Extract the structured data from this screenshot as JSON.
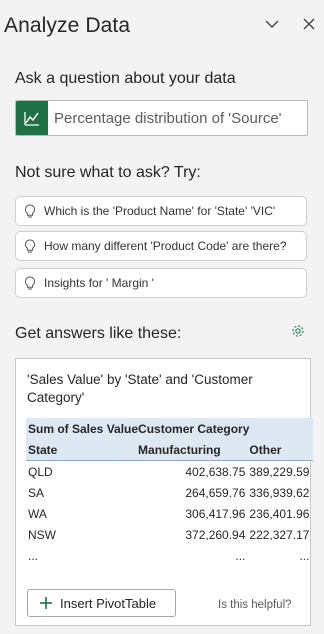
{
  "pane": {
    "title": "Analyze Data"
  },
  "ask": {
    "heading": "Ask a question about your data",
    "value": "Percentage distribution of 'Source'"
  },
  "suggestions": {
    "heading": "Not sure what to ask? Try:",
    "items": [
      {
        "label": "Which is the 'Product Name' for 'State' 'VIC'"
      },
      {
        "label": "How many different 'Product Code' are there?"
      },
      {
        "label": "Insights for ' Margin '"
      }
    ]
  },
  "answers": {
    "heading": "Get answers like these:",
    "card": {
      "title": "'Sales Value' by 'State' and 'Customer Category'",
      "header_row1": [
        "Sum of Sales Value",
        "Customer Category",
        ""
      ],
      "header_row2": [
        "State",
        "Manufacturing",
        "Other"
      ],
      "rows": [
        [
          "QLD",
          "402,638.75",
          "389,229.59"
        ],
        [
          "SA",
          "264,659.76",
          "336,939.62"
        ],
        [
          "WA",
          "306,417.96",
          "236,401.96"
        ],
        [
          "NSW",
          "372,260.94",
          "222,327.17"
        ],
        [
          "...",
          "...",
          "..."
        ]
      ],
      "insert_label": "Insert PivotTable",
      "helpful_label": "Is this helpful?"
    }
  },
  "colors": {
    "accent_green": "#1e7145",
    "table_header": "#dde8f3"
  },
  "icons": [
    "chevron-down-icon",
    "close-icon",
    "chart-icon",
    "lightbulb-icon",
    "gear-icon",
    "plus-icon"
  ]
}
